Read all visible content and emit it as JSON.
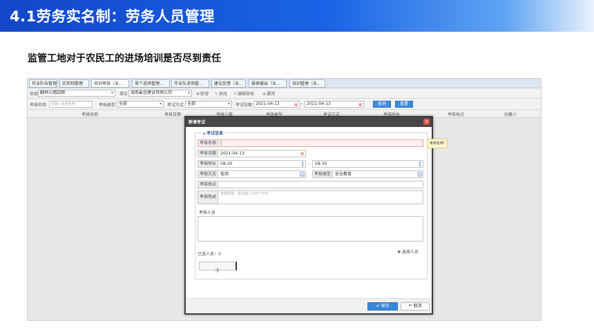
{
  "slide": {
    "title": "4.1劳务实名制：劳务人员管理",
    "subtitle": "监管工地对于农民工的进场培训是否尽到责任"
  },
  "tabs": [
    "作业队伍管理",
    "实名制管理",
    "培训考核（业...",
    "单个进场管理...",
    "作业队进场管...",
    "建议反馈（业...",
    "报表输出（业...",
    "培训管理（业..."
  ],
  "toolbar": {
    "project_label": "项目",
    "project_value": "翻林公墙四期",
    "unit_label": "单位",
    "unit_value": "湖南最佳建设有限公司",
    "add": "新增",
    "edit": "修改",
    "edit_review": "编辑审核",
    "delete": "删除"
  },
  "filters": {
    "name_label": "考核名称",
    "name_placeholder": "请输入考核名称",
    "type_label": "考核类型",
    "type_value": "全部",
    "method_label": "考试方式",
    "method_value": "全部",
    "date_label": "考试日期",
    "date_from": "2021-04-13",
    "date_sep": "-",
    "date_to": "2021-04-13",
    "query": "查询",
    "reset": "重置"
  },
  "table_headers": [
    "考核名称",
    "考核日期",
    "考核人数",
    "考核类型",
    "考试方式",
    "考核时长",
    "考核地点",
    "创建人"
  ],
  "modal": {
    "title": "新增考试",
    "close": "×",
    "section_legend": "考试信息",
    "fields": {
      "name_label": "考核名称",
      "name_value": "|",
      "name_tip": "考核名称!",
      "date_label": "考核日期",
      "date_value": "2021-04-13",
      "duration_label": "考核时长",
      "duration_from": "08:30",
      "duration_sep": "-",
      "duration_to": "08:30",
      "method_label": "考核方式",
      "method_value": "现场",
      "type_label": "考核类型",
      "type_value": "安全教育",
      "place_label": "考核地点",
      "desc_label": "考核简述",
      "desc_placeholder": "考核简述：最多输入200个字符",
      "people_label": "考核人员",
      "selected_count": "已选人员：0",
      "select_people": "选择人员"
    },
    "save": "保存",
    "cancel": "取消"
  },
  "colors": {
    "banner_start": "#1346c8",
    "banner_end": "#eaf2fd",
    "primary_button": "#3a87d8",
    "modal_header": "#474747",
    "close_button": "#d9534f"
  }
}
